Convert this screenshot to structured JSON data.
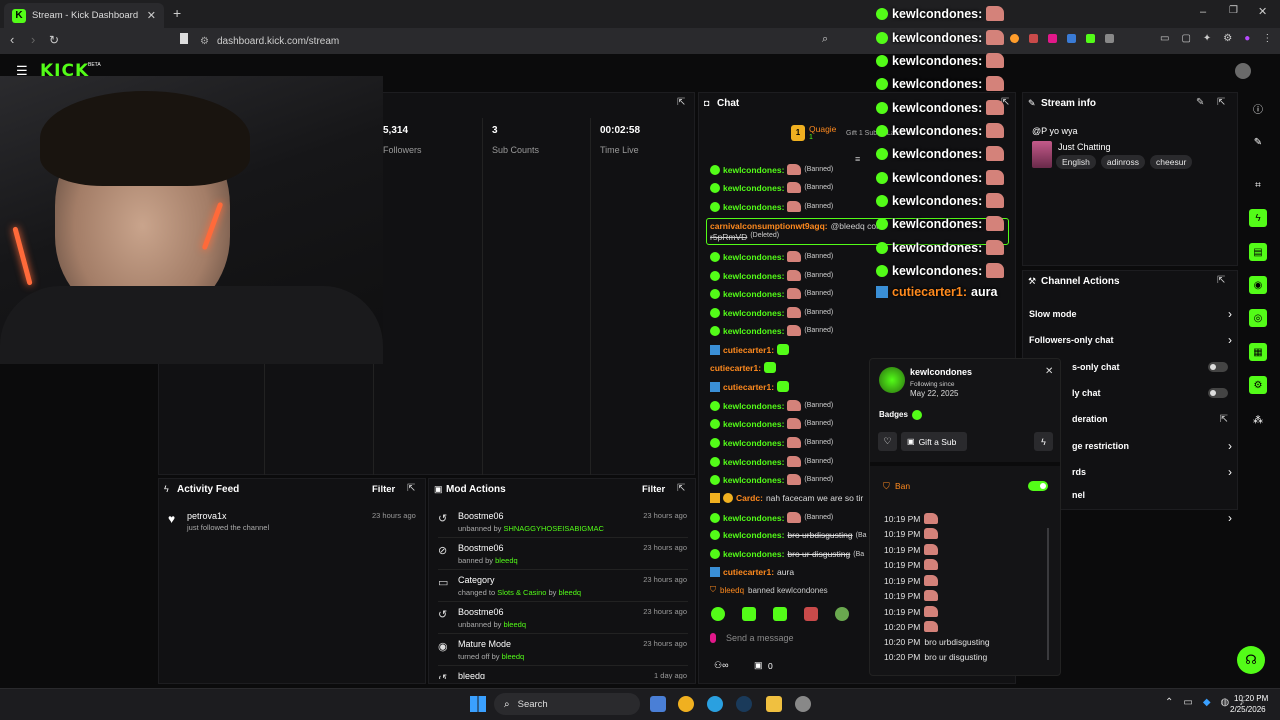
{
  "browser": {
    "tab_title": "Stream - Kick Dashboard",
    "url": "dashboard.kick.com/stream",
    "new_tab": "+"
  },
  "app": {
    "logo": "KICK",
    "logo_badge": "BETA"
  },
  "stats": [
    {
      "value": "5,314",
      "label": "Followers"
    },
    {
      "value": "3",
      "label": "Sub Counts"
    },
    {
      "value": "00:02:58",
      "label": "Time Live"
    }
  ],
  "chat": {
    "title": "Chat",
    "pinned_user": "Quagie",
    "pinned_count": "1",
    "gift_text": "Gift 1 Sub to Latest Joined",
    "messages": [
      {
        "user": "kewlcondones:",
        "kind": "banned",
        "badge": "verified",
        "status": "(Banned)"
      },
      {
        "user": "kewlcondones:",
        "kind": "banned",
        "badge": "verified",
        "status": "(Banned)"
      },
      {
        "user": "kewlcondones:",
        "kind": "banned",
        "badge": "verified",
        "status": "(Banned)"
      },
      {
        "user": "carnivalconsumptionwt9agq:",
        "kind": "deleted",
        "text": "@bleedq com",
        "text2": "r5pRmVD",
        "status": "(Deleted)"
      },
      {
        "user": "kewlcondones:",
        "kind": "banned",
        "badge": "verified",
        "status": "(Banned)"
      },
      {
        "user": "kewlcondones:",
        "kind": "banned",
        "badge": "verified",
        "status": "(Banned)"
      },
      {
        "user": "kewlcondones:",
        "kind": "banned",
        "badge": "verified",
        "status": "(Banned)"
      },
      {
        "user": "kewlcondones:",
        "kind": "banned",
        "badge": "verified",
        "status": "(Banned)"
      },
      {
        "user": "kewlcondones:",
        "kind": "banned",
        "badge": "verified",
        "status": "(Banned)"
      },
      {
        "user": "cutiecarter1:",
        "kind": "emote",
        "badge": "sub"
      },
      {
        "user": "cutiecarter1:",
        "kind": "emote",
        "badge": "none"
      },
      {
        "user": "cutiecarter1:",
        "kind": "emote",
        "badge": "sub"
      },
      {
        "user": "kewlcondones:",
        "kind": "banned",
        "badge": "verified",
        "status": "(Banned)"
      },
      {
        "user": "kewlcondones:",
        "kind": "banned",
        "badge": "verified",
        "status": "(Banned)"
      },
      {
        "user": "kewlcondones:",
        "kind": "banned",
        "badge": "verified",
        "status": "(Banned)"
      },
      {
        "user": "kewlcondones:",
        "kind": "banned",
        "badge": "verified",
        "status": "(Banned)"
      },
      {
        "user": "kewlcondones:",
        "kind": "banned",
        "badge": "verified",
        "status": "(Banned)"
      },
      {
        "user": "Cardc:",
        "kind": "text",
        "badge": "crown",
        "text": "nah facecam we are so tir"
      },
      {
        "user": "kewlcondones:",
        "kind": "banned",
        "badge": "verified",
        "status": "(Banned)"
      },
      {
        "user": "kewlcondones:",
        "kind": "strike",
        "badge": "verified",
        "text": "bro urbdisgusting",
        "status": "(Ba"
      },
      {
        "user": "kewlcondones:",
        "kind": "strike",
        "badge": "verified",
        "text": "bro ur disgusting",
        "status": "(Ba"
      },
      {
        "user": "cutiecarter1:",
        "kind": "text",
        "badge": "sub",
        "text": "aura"
      }
    ],
    "mod_note_user": "bleedq",
    "mod_note_text": "banned kewlcondones",
    "input_placeholder": "Send a message",
    "footer_count": "0"
  },
  "overlay": {
    "lines": [
      "kewlcondones:",
      "kewlcondones:",
      "kewlcondones:",
      "kewlcondones:",
      "kewlcondones:",
      "kewlcondones:",
      "kewlcondones:",
      "kewlcondones:",
      "kewlcondones:",
      "kewlcondones:",
      "kewlcondones:",
      "kewlcondones:"
    ],
    "last_user": "cutiecarter1:",
    "last_text": "aura"
  },
  "popup": {
    "username": "kewlcondones",
    "following_since_label": "Following since",
    "following_since": "May 22, 2025",
    "badges_label": "Badges",
    "gift_sub": "Gift a Sub",
    "ban_label": "Ban",
    "times": [
      "10:19 PM",
      "10:19 PM",
      "10:19 PM",
      "10:19 PM",
      "10:19 PM",
      "10:19 PM",
      "10:19 PM",
      "10:20 PM"
    ],
    "time_msgs": [
      {
        "time": "10:20 PM",
        "text": "bro urbdisgusting"
      },
      {
        "time": "10:20 PM",
        "text": "bro ur disgusting"
      }
    ]
  },
  "stream_info": {
    "title": "Stream info",
    "stream_title": "@P yo wya",
    "category": "Just Chatting",
    "tags": [
      "English",
      "adinross",
      "cheesur"
    ]
  },
  "channel_actions": {
    "title": "Channel Actions",
    "items": [
      {
        "label": "Slow mode",
        "control": "chevron"
      },
      {
        "label": "Followers-only chat",
        "control": "chevron"
      },
      {
        "label": "s-only chat",
        "control": "toggle"
      },
      {
        "label": "ly chat",
        "control": "toggle"
      },
      {
        "label": "deration",
        "control": "link"
      },
      {
        "label": "ge restriction",
        "control": "chevron"
      },
      {
        "label": "rds",
        "control": "chevron"
      },
      {
        "label": "nel",
        "control": "none"
      },
      {
        "label": "",
        "control": "chevron"
      }
    ]
  },
  "activity": {
    "title": "Activity Feed",
    "filter": "Filter",
    "items": [
      {
        "user": "petrova1x",
        "text": "just followed the channel",
        "ago": "23 hours ago"
      }
    ]
  },
  "mod_actions": {
    "title": "Mod Actions",
    "filter": "Filter",
    "items": [
      {
        "title": "Boostme06",
        "pre": "unbanned by",
        "by": "SHNAGGYHOSEISABIGMAC",
        "ago": "23 hours ago",
        "icon": "undo-icon"
      },
      {
        "title": "Boostme06",
        "pre": "banned by",
        "by": "bleedq",
        "ago": "23 hours ago",
        "icon": "ban-icon"
      },
      {
        "title": "Category",
        "pre": "changed to",
        "mid": "Slots & Casino",
        "by": "bleedq",
        "ago": "23 hours ago",
        "icon": "category-icon"
      },
      {
        "title": "Boostme06",
        "pre": "unbanned by",
        "by": "bleedq",
        "ago": "23 hours ago",
        "icon": "undo-icon"
      },
      {
        "title": "Mature Mode",
        "pre": "turned off by",
        "by": "bleedq",
        "ago": "23 hours ago",
        "icon": "eye-icon"
      },
      {
        "title": "bleedq",
        "pre": "",
        "by": "",
        "ago": "1 day ago",
        "icon": "undo-icon"
      }
    ]
  },
  "taskbar": {
    "search": "Search",
    "time": "10:20 PM",
    "date": "2/25/2026"
  },
  "colors": {
    "accent": "#53fc18",
    "panel": "#111113",
    "orange": "#ff8a1e",
    "sub_blue": "#3a8fd6"
  }
}
